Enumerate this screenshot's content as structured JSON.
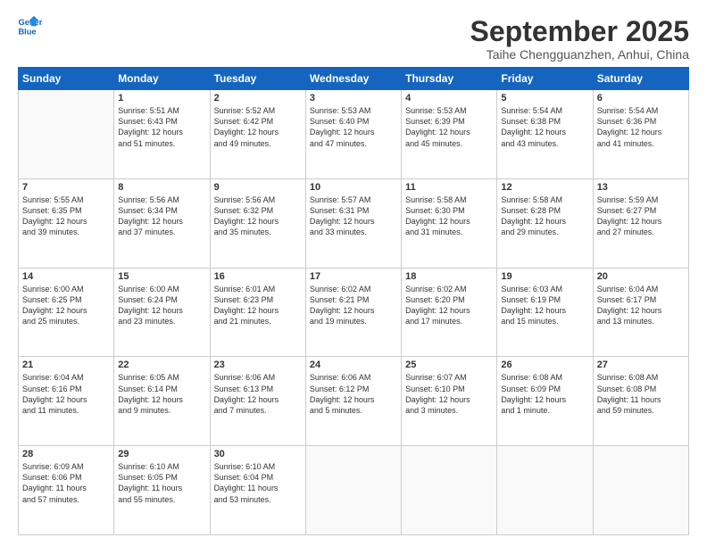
{
  "header": {
    "logo_line1": "General",
    "logo_line2": "Blue",
    "month": "September 2025",
    "location": "Taihe Chengguanzhen, Anhui, China"
  },
  "days_of_week": [
    "Sunday",
    "Monday",
    "Tuesday",
    "Wednesday",
    "Thursday",
    "Friday",
    "Saturday"
  ],
  "weeks": [
    [
      {
        "day": "",
        "info": ""
      },
      {
        "day": "1",
        "info": "Sunrise: 5:51 AM\nSunset: 6:43 PM\nDaylight: 12 hours\nand 51 minutes."
      },
      {
        "day": "2",
        "info": "Sunrise: 5:52 AM\nSunset: 6:42 PM\nDaylight: 12 hours\nand 49 minutes."
      },
      {
        "day": "3",
        "info": "Sunrise: 5:53 AM\nSunset: 6:40 PM\nDaylight: 12 hours\nand 47 minutes."
      },
      {
        "day": "4",
        "info": "Sunrise: 5:53 AM\nSunset: 6:39 PM\nDaylight: 12 hours\nand 45 minutes."
      },
      {
        "day": "5",
        "info": "Sunrise: 5:54 AM\nSunset: 6:38 PM\nDaylight: 12 hours\nand 43 minutes."
      },
      {
        "day": "6",
        "info": "Sunrise: 5:54 AM\nSunset: 6:36 PM\nDaylight: 12 hours\nand 41 minutes."
      }
    ],
    [
      {
        "day": "7",
        "info": "Sunrise: 5:55 AM\nSunset: 6:35 PM\nDaylight: 12 hours\nand 39 minutes."
      },
      {
        "day": "8",
        "info": "Sunrise: 5:56 AM\nSunset: 6:34 PM\nDaylight: 12 hours\nand 37 minutes."
      },
      {
        "day": "9",
        "info": "Sunrise: 5:56 AM\nSunset: 6:32 PM\nDaylight: 12 hours\nand 35 minutes."
      },
      {
        "day": "10",
        "info": "Sunrise: 5:57 AM\nSunset: 6:31 PM\nDaylight: 12 hours\nand 33 minutes."
      },
      {
        "day": "11",
        "info": "Sunrise: 5:58 AM\nSunset: 6:30 PM\nDaylight: 12 hours\nand 31 minutes."
      },
      {
        "day": "12",
        "info": "Sunrise: 5:58 AM\nSunset: 6:28 PM\nDaylight: 12 hours\nand 29 minutes."
      },
      {
        "day": "13",
        "info": "Sunrise: 5:59 AM\nSunset: 6:27 PM\nDaylight: 12 hours\nand 27 minutes."
      }
    ],
    [
      {
        "day": "14",
        "info": "Sunrise: 6:00 AM\nSunset: 6:25 PM\nDaylight: 12 hours\nand 25 minutes."
      },
      {
        "day": "15",
        "info": "Sunrise: 6:00 AM\nSunset: 6:24 PM\nDaylight: 12 hours\nand 23 minutes."
      },
      {
        "day": "16",
        "info": "Sunrise: 6:01 AM\nSunset: 6:23 PM\nDaylight: 12 hours\nand 21 minutes."
      },
      {
        "day": "17",
        "info": "Sunrise: 6:02 AM\nSunset: 6:21 PM\nDaylight: 12 hours\nand 19 minutes."
      },
      {
        "day": "18",
        "info": "Sunrise: 6:02 AM\nSunset: 6:20 PM\nDaylight: 12 hours\nand 17 minutes."
      },
      {
        "day": "19",
        "info": "Sunrise: 6:03 AM\nSunset: 6:19 PM\nDaylight: 12 hours\nand 15 minutes."
      },
      {
        "day": "20",
        "info": "Sunrise: 6:04 AM\nSunset: 6:17 PM\nDaylight: 12 hours\nand 13 minutes."
      }
    ],
    [
      {
        "day": "21",
        "info": "Sunrise: 6:04 AM\nSunset: 6:16 PM\nDaylight: 12 hours\nand 11 minutes."
      },
      {
        "day": "22",
        "info": "Sunrise: 6:05 AM\nSunset: 6:14 PM\nDaylight: 12 hours\nand 9 minutes."
      },
      {
        "day": "23",
        "info": "Sunrise: 6:06 AM\nSunset: 6:13 PM\nDaylight: 12 hours\nand 7 minutes."
      },
      {
        "day": "24",
        "info": "Sunrise: 6:06 AM\nSunset: 6:12 PM\nDaylight: 12 hours\nand 5 minutes."
      },
      {
        "day": "25",
        "info": "Sunrise: 6:07 AM\nSunset: 6:10 PM\nDaylight: 12 hours\nand 3 minutes."
      },
      {
        "day": "26",
        "info": "Sunrise: 6:08 AM\nSunset: 6:09 PM\nDaylight: 12 hours\nand 1 minute."
      },
      {
        "day": "27",
        "info": "Sunrise: 6:08 AM\nSunset: 6:08 PM\nDaylight: 11 hours\nand 59 minutes."
      }
    ],
    [
      {
        "day": "28",
        "info": "Sunrise: 6:09 AM\nSunset: 6:06 PM\nDaylight: 11 hours\nand 57 minutes."
      },
      {
        "day": "29",
        "info": "Sunrise: 6:10 AM\nSunset: 6:05 PM\nDaylight: 11 hours\nand 55 minutes."
      },
      {
        "day": "30",
        "info": "Sunrise: 6:10 AM\nSunset: 6:04 PM\nDaylight: 11 hours\nand 53 minutes."
      },
      {
        "day": "",
        "info": ""
      },
      {
        "day": "",
        "info": ""
      },
      {
        "day": "",
        "info": ""
      },
      {
        "day": "",
        "info": ""
      }
    ]
  ]
}
